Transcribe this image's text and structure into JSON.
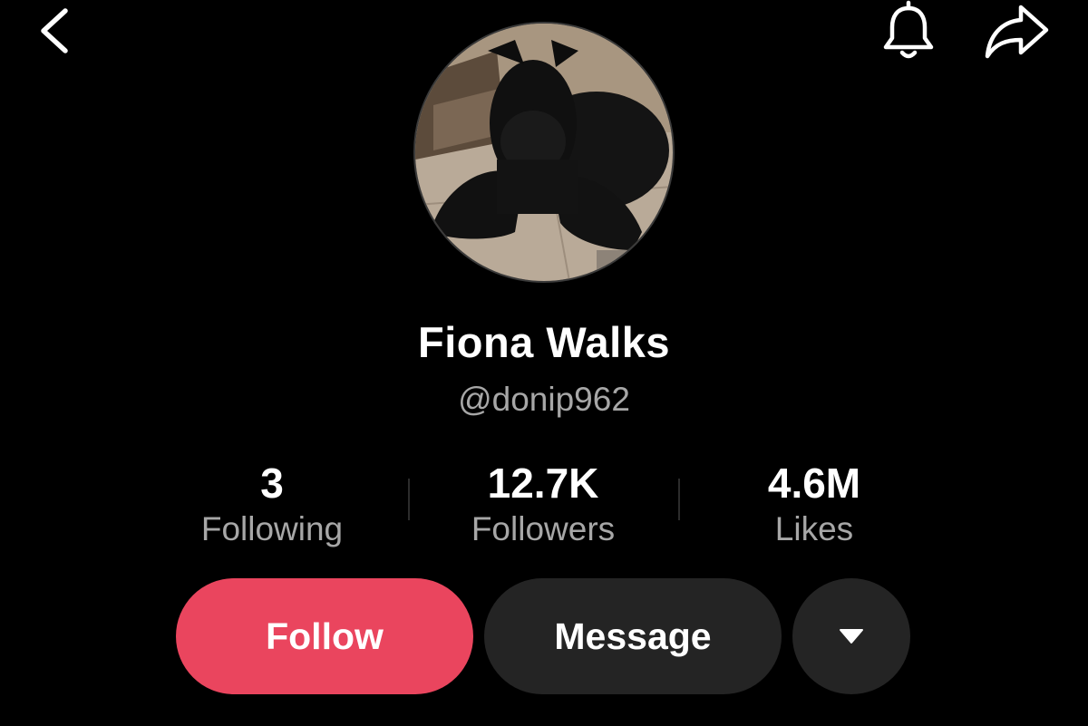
{
  "header": {
    "back_icon": "chevron-left-icon",
    "notification_icon": "bell-icon",
    "share_icon": "share-arrow-icon"
  },
  "profile": {
    "avatar": "black-dog-photo",
    "display_name": "Fiona Walks",
    "handle": "@donip962"
  },
  "stats": {
    "following": {
      "value": "3",
      "label": "Following"
    },
    "followers": {
      "value": "12.7K",
      "label": "Followers"
    },
    "likes": {
      "value": "4.6M",
      "label": "Likes"
    }
  },
  "actions": {
    "follow_label": "Follow",
    "message_label": "Message",
    "more_icon": "caret-down-icon"
  },
  "colors": {
    "background": "#000000",
    "accent": "#ea455e",
    "secondary_button": "#242424",
    "muted_text": "#a7a7a7"
  }
}
